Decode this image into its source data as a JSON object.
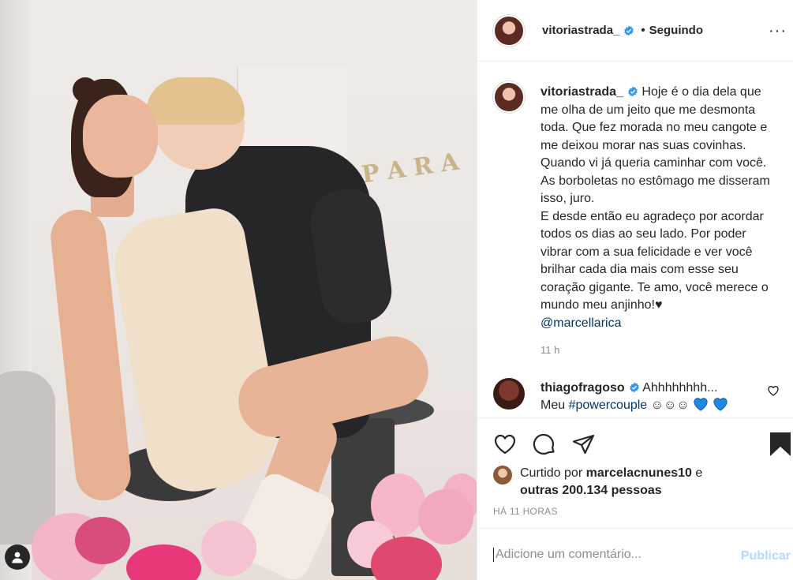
{
  "post": {
    "username": "vitoriastrada_",
    "follow_status": "Seguindo",
    "follow_dot": "•",
    "more_label": "···",
    "verified_color": "#3897f0",
    "caption": {
      "username": "vitoriastrada_",
      "text": "Hoje é o dia dela que me olha de um jeito que me desmonta toda. Que fez morada no meu cangote e me deixou morar nas suas covinhas. Quando vi já queria caminhar com você. As borboletas no estômago me disseram isso, juro.\nE desde então eu agradeço por acordar todos os dias ao seu lado. Por poder vibrar com a sua felicidade e ver você brilhar cada dia mais com esse seu coração gigante. Te amo, você merece o mundo meu anjinho!♥",
      "mention": "@marcellarica",
      "time": "11 h"
    },
    "reply": {
      "username": "thiagofragoso",
      "text_start": "Ahhhhhhhh...",
      "text_meu": "Meu",
      "hashtag": "#powercouple",
      "emojis": "☺☺☺"
    },
    "likes": {
      "prefix": "Curtido por",
      "user": "marcelacnunes10",
      "joiner": "e",
      "others": "outras 200.134 pessoas"
    },
    "posted_ago": "HÁ 11 HORAS",
    "comment_input": {
      "placeholder": "Adicione um comentário...",
      "value": ""
    },
    "publish_label": "Publicar",
    "publish_color": "#b3dbff"
  },
  "photo": {
    "banner_letters": [
      "P",
      "A",
      "R",
      "A"
    ]
  },
  "icons": {
    "like": "heart-icon",
    "comment": "comment-icon",
    "share": "share-icon",
    "save": "bookmark-icon",
    "user_tag": "user-icon"
  }
}
